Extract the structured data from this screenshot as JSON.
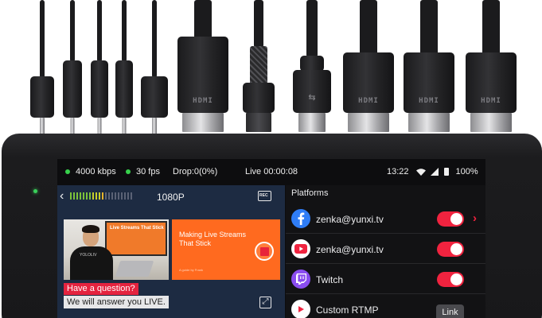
{
  "status_bar": {
    "bitrate": "4000 kbps",
    "fps": "30 fps",
    "drop": "Drop:0(0%)",
    "live_timer": "Live 00:00:08",
    "clock": "13:22",
    "battery": "100%",
    "indicator_color": "#37d14c"
  },
  "preview": {
    "resolution": "1080P",
    "audio_level": 0.55,
    "monitor_text": "Live Streams That Stick",
    "slide_title": "Making Live Streams That Stick",
    "slide_subtitle": "A guide by Frank",
    "shirt_text": "YOLOLIV",
    "caption_question": "Have a question?",
    "caption_answer": "We will answer you LIVE."
  },
  "platforms": {
    "title": "Platforms",
    "accent_color": "#f0233f",
    "items": [
      {
        "icon": "facebook-icon",
        "label": "zenka@yunxi.tv",
        "enabled": true,
        "has_chevron": true
      },
      {
        "icon": "youtube-icon",
        "label": "zenka@yunxi.tv",
        "enabled": true
      },
      {
        "icon": "twitch-icon",
        "label": "Twitch",
        "enabled": true
      },
      {
        "icon": "rtmp-icon",
        "label": "Custom RTMP",
        "action": "Link"
      }
    ]
  },
  "hardware": {
    "hdmi_label": "HDMI"
  }
}
